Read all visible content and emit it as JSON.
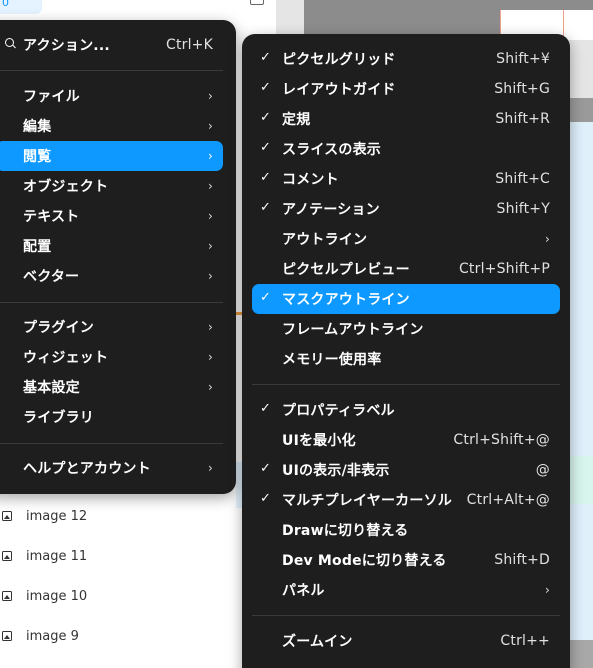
{
  "layers": {
    "top_chip": "0",
    "rows": [
      {
        "label": "image 12"
      },
      {
        "label": "image 11"
      },
      {
        "label": "image 10"
      },
      {
        "label": "image 9"
      }
    ]
  },
  "main_menu": {
    "search": {
      "label": "アクション...",
      "shortcut": "Ctrl+K"
    },
    "items": [
      {
        "label": "ファイル",
        "arrow": "›"
      },
      {
        "label": "編集",
        "arrow": "›"
      },
      {
        "label": "閲覧",
        "arrow": "›"
      },
      {
        "label": "オブジェクト",
        "arrow": "›"
      },
      {
        "label": "テキスト",
        "arrow": "›"
      },
      {
        "label": "配置",
        "arrow": "›"
      },
      {
        "label": "ベクター",
        "arrow": "›"
      },
      {
        "label": "プラグイン",
        "arrow": "›"
      },
      {
        "label": "ウィジェット",
        "arrow": "›"
      },
      {
        "label": "基本設定",
        "arrow": "›"
      },
      {
        "label": "ライブラリ",
        "arrow": ""
      },
      {
        "label": "ヘルプとアカウント",
        "arrow": "›"
      }
    ]
  },
  "view_menu": {
    "check_glyph": "✓",
    "items": [
      {
        "label": "ピクセルグリッド",
        "shortcut": "Shift+¥",
        "checked": true
      },
      {
        "label": "レイアウトガイド",
        "shortcut": "Shift+G",
        "checked": true
      },
      {
        "label": "定規",
        "shortcut": "Shift+R",
        "checked": true
      },
      {
        "label": "スライスの表示",
        "shortcut": "",
        "checked": true
      },
      {
        "label": "コメント",
        "shortcut": "Shift+C",
        "checked": true
      },
      {
        "label": "アノテーション",
        "shortcut": "Shift+Y",
        "checked": true
      },
      {
        "label": "アウトライン",
        "shortcut": "›",
        "checked": false
      },
      {
        "label": "ピクセルプレビュー",
        "shortcut": "Ctrl+Shift+P",
        "checked": false
      },
      {
        "label": "マスクアウトライン",
        "shortcut": "",
        "checked": true
      },
      {
        "label": "フレームアウトライン",
        "shortcut": "",
        "checked": false
      },
      {
        "label": "メモリー使用率",
        "shortcut": "",
        "checked": false
      },
      {
        "label": "プロパティラベル",
        "shortcut": "",
        "checked": true
      },
      {
        "label": "UIを最小化",
        "shortcut": "Ctrl+Shift+@",
        "checked": false
      },
      {
        "label": "UIの表示/非表示",
        "shortcut": "@",
        "checked": true
      },
      {
        "label": "マルチプレイヤーカーソル",
        "shortcut": "Ctrl+Alt+@",
        "checked": true
      },
      {
        "label": "Drawに切り替える",
        "shortcut": "",
        "checked": false
      },
      {
        "label": "Dev Modeに切り替える",
        "shortcut": "Shift+D",
        "checked": false
      },
      {
        "label": "パネル",
        "shortcut": "›",
        "checked": false
      },
      {
        "label": "ズームイン",
        "shortcut": "Ctrl++",
        "checked": false
      }
    ]
  },
  "colors": {
    "menu_bg": "#1e1e1e",
    "accent": "#0d99ff",
    "separator": "#3a3a3a"
  }
}
